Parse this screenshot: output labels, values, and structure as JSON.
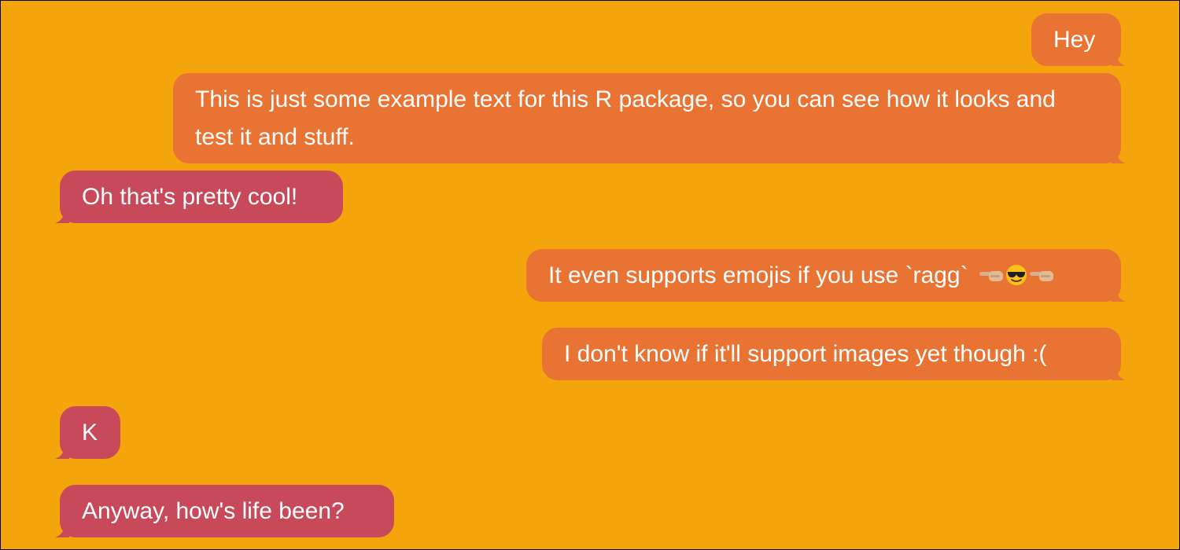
{
  "colors": {
    "background": "#f5a50c",
    "sent_bubble": "#e97333",
    "received_bubble": "#c8495a",
    "text": "#ffffff"
  },
  "messages": [
    {
      "side": "right",
      "text": "Hey"
    },
    {
      "side": "right",
      "text": "This is just some example text for this R package, so you can see how it looks and test it and stuff."
    },
    {
      "side": "left",
      "text": "Oh that's pretty cool!"
    },
    {
      "side": "right",
      "text": "It even supports emojis if you use `ragg`",
      "emojis": [
        "pointing-left-hand-icon",
        "smiling-face-with-sunglasses-icon",
        "pointing-left-hand-icon"
      ]
    },
    {
      "side": "right",
      "text": "I don't know if it'll support images yet though :("
    },
    {
      "side": "left",
      "text": "K"
    },
    {
      "side": "left",
      "text": "Anyway, how's life been?"
    }
  ]
}
